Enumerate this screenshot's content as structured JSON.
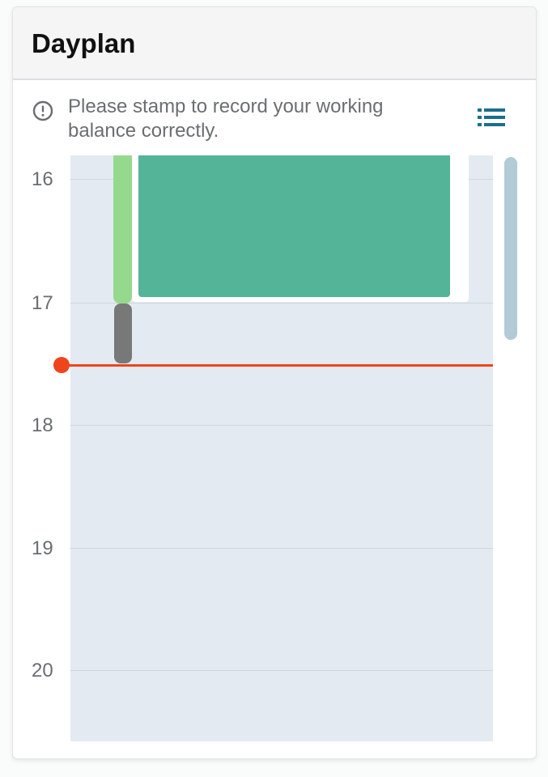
{
  "header": {
    "title": "Dayplan"
  },
  "notice": {
    "icon": "info-circle-icon",
    "text": "Please stamp to record your working balance correctly."
  },
  "toolbar": {
    "list_view_icon": "list-icon"
  },
  "timeline": {
    "hours": [
      "16",
      "17",
      "18",
      "19",
      "20"
    ],
    "current_time_hour": 17.5,
    "colors": {
      "event": "#53b497",
      "stamp_in": "#95d98e",
      "stamp_gap": "#787878",
      "now_line": "#f0441c",
      "background": "#e4eaf1",
      "accent": "#1b6f8c"
    }
  }
}
